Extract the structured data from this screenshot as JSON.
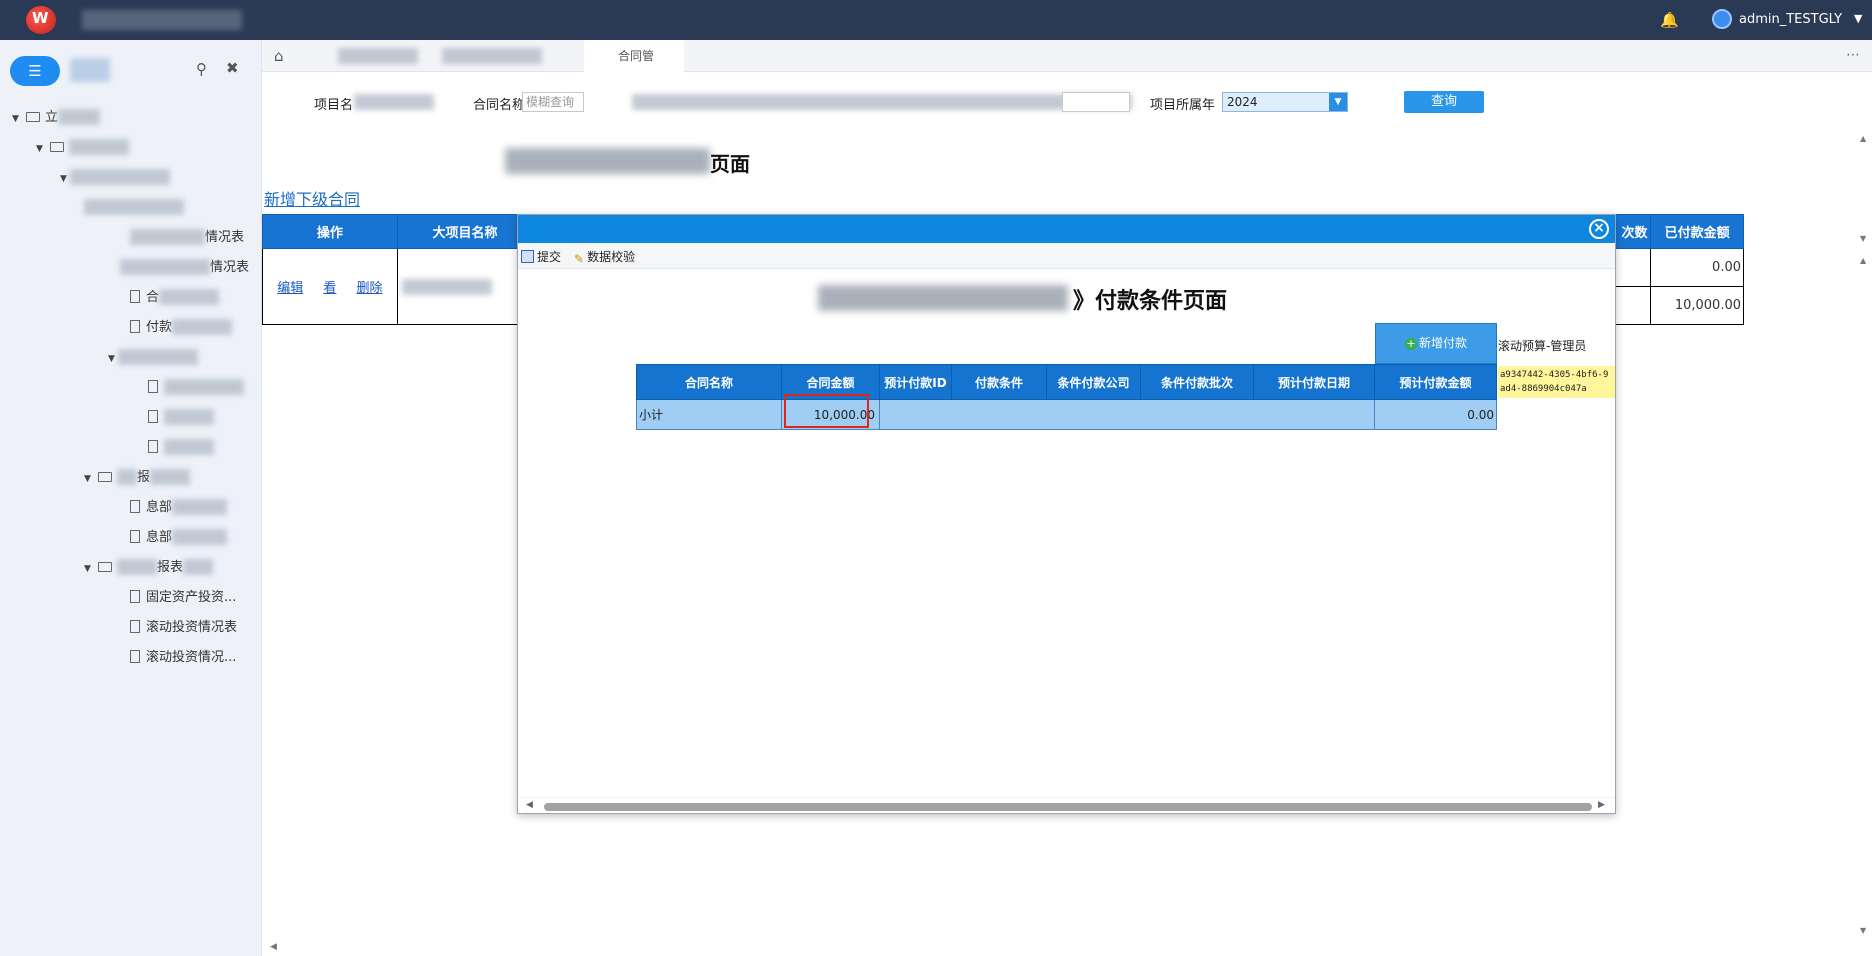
{
  "user": {
    "name": "admin_TESTGLY"
  },
  "sidebar": {
    "tree": {
      "root_label_start": "立",
      "sub_items": [
        "情况表",
        "情况表",
        "合",
        "付款",
        "",
        "",
        "",
        "",
        "报",
        "息部",
        "息部",
        "报表",
        "固定资产投资...",
        "滚动投资情况表",
        "滚动投资情况..."
      ]
    }
  },
  "tabs": {
    "active_partial": "合同管"
  },
  "filters": {
    "project_label_partial": "项目名",
    "contract_label": "合同名称",
    "contract_placeholder": "模糊查询",
    "year_label": "项目所属年",
    "year_value": "2024",
    "query_button": "查询"
  },
  "main": {
    "title_tail": "页面",
    "add_sub_link": "新增下级合同",
    "table": {
      "headers": {
        "op": "操作",
        "big_project": "大项目名称",
        "count_tail": "次数",
        "paid": "已付款金额"
      },
      "row": {
        "edit": "编辑",
        "view_partial": "看",
        "delete": "删除"
      },
      "paid_values": [
        "0.00",
        "10,000.00"
      ]
    }
  },
  "modal": {
    "toolbar": {
      "submit": "提交",
      "validate": "数据校验"
    },
    "title_tail": "》付款条件页面",
    "add_payment": "新增付款",
    "side_note": "滚动预算-管理员",
    "uuid": "a9347442-4305-4bf6-9ad4-8869904c047a",
    "table": {
      "headers": [
        "合同名称",
        "合同金额",
        "预计付款ID",
        "付款条件",
        "条件付款公司",
        "条件付款批次",
        "预计付款日期",
        "预计付款金额"
      ],
      "subtotal": {
        "label": "小计",
        "contract_amount": "10,000.00",
        "planned_payment": "0.00"
      }
    }
  }
}
